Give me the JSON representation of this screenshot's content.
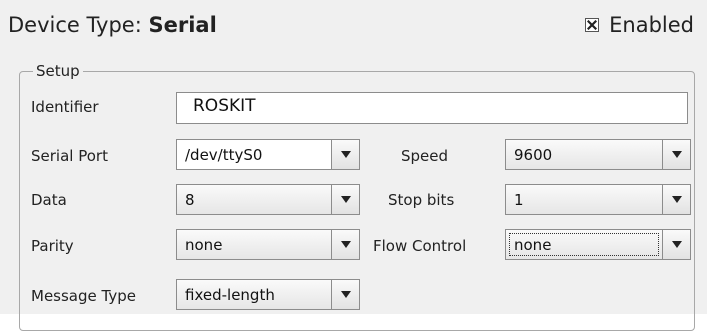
{
  "header": {
    "device_type_label": "Device Type:",
    "device_type_value": "Serial",
    "enabled_label": "Enabled",
    "enabled_checked": true
  },
  "setup": {
    "title": "Setup",
    "identifier_label": "Identifier",
    "identifier_value": "ROSKIT",
    "serial_port_label": "Serial Port",
    "serial_port_value": "/dev/ttyS0",
    "speed_label": "Speed",
    "speed_value": "9600",
    "data_label": "Data",
    "data_value": "8",
    "stop_bits_label": "Stop bits",
    "stop_bits_value": "1",
    "parity_label": "Parity",
    "parity_value": "none",
    "flow_control_label": "Flow Control",
    "flow_control_value": "none",
    "message_type_label": "Message Type",
    "message_type_value": "fixed-length"
  },
  "icons": {
    "combo_arrow": "triangle-down-icon",
    "checkbox_mark": "x-mark-icon"
  }
}
